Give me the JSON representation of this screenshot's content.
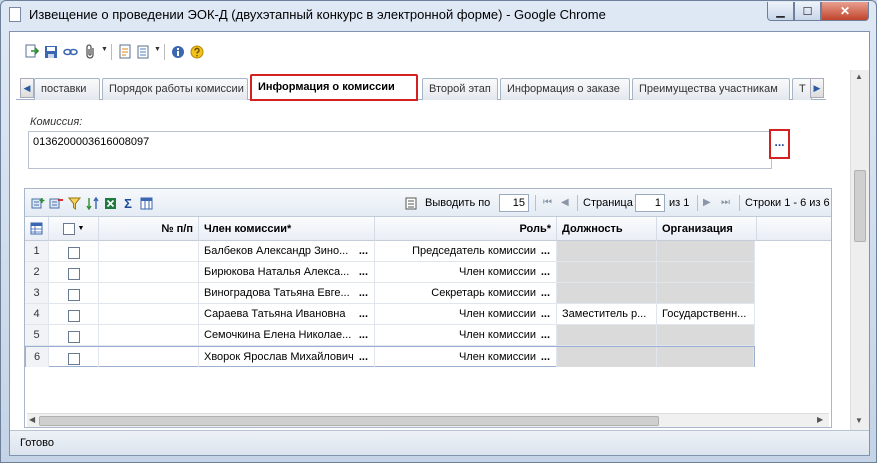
{
  "window": {
    "title": "Извещение о проведении ЭОК-Д (двухэтапный конкурс в электронной форме) - Google Chrome",
    "min_glyph": "▁",
    "max_glyph": "☐",
    "close_glyph": "✕"
  },
  "toolbar": {
    "icons": [
      "export-icon",
      "save-icon",
      "link-icon",
      "attach-icon",
      "document-icon",
      "print-icon",
      "info-icon",
      "help-icon"
    ]
  },
  "tabs": {
    "left_arrow": "◀",
    "right_arrow": "▶",
    "items": [
      {
        "label": "поставки"
      },
      {
        "label": "Порядок работы комиссии"
      },
      {
        "label": "Информация о комиссии"
      },
      {
        "label": "Второй этап"
      },
      {
        "label": "Информация о заказе"
      },
      {
        "label": "Преимущества участникам"
      },
      {
        "label": "Т"
      }
    ],
    "active_index": 2
  },
  "commission": {
    "label": "Комиссия:",
    "value": "0136200003616008097",
    "button_label": "..."
  },
  "grid_toolbar": {
    "per_page_label": "Выводить по",
    "per_page_value": "15",
    "page_label": "Страница",
    "page_value": "1",
    "of_label": "из 1",
    "rows_label": "Строки 1 - 6 из 6"
  },
  "grid": {
    "columns": {
      "num": "№ п/п",
      "member": "Член комиссии*",
      "role": "Роль*",
      "position": "Должность",
      "organization": "Организация"
    },
    "rows": [
      {
        "idx": "1",
        "num": "",
        "member": "Балбеков Александр Зино...",
        "role": "Председатель комиссии",
        "position": "",
        "organization": ""
      },
      {
        "idx": "2",
        "num": "",
        "member": "Бирюкова Наталья Алекса...",
        "role": "Член комиссии",
        "position": "",
        "organization": ""
      },
      {
        "idx": "3",
        "num": "",
        "member": "Виноградова Татьяна Евге...",
        "role": "Секретарь комиссии",
        "position": "",
        "organization": ""
      },
      {
        "idx": "4",
        "num": "",
        "member": "Сараева Татьяна Ивановна",
        "role": "Член комиссии",
        "position": "Заместитель р...",
        "organization": "Государственн..."
      },
      {
        "idx": "5",
        "num": "",
        "member": "Семочкина Елена Николае...",
        "role": "Член комиссии",
        "position": "",
        "organization": ""
      },
      {
        "idx": "6",
        "num": "",
        "member": "Хворок Ярослав Михайлович",
        "role": "Член комиссии",
        "position": "",
        "organization": ""
      }
    ],
    "cell_button": "..."
  },
  "status": {
    "text": "Готово"
  }
}
